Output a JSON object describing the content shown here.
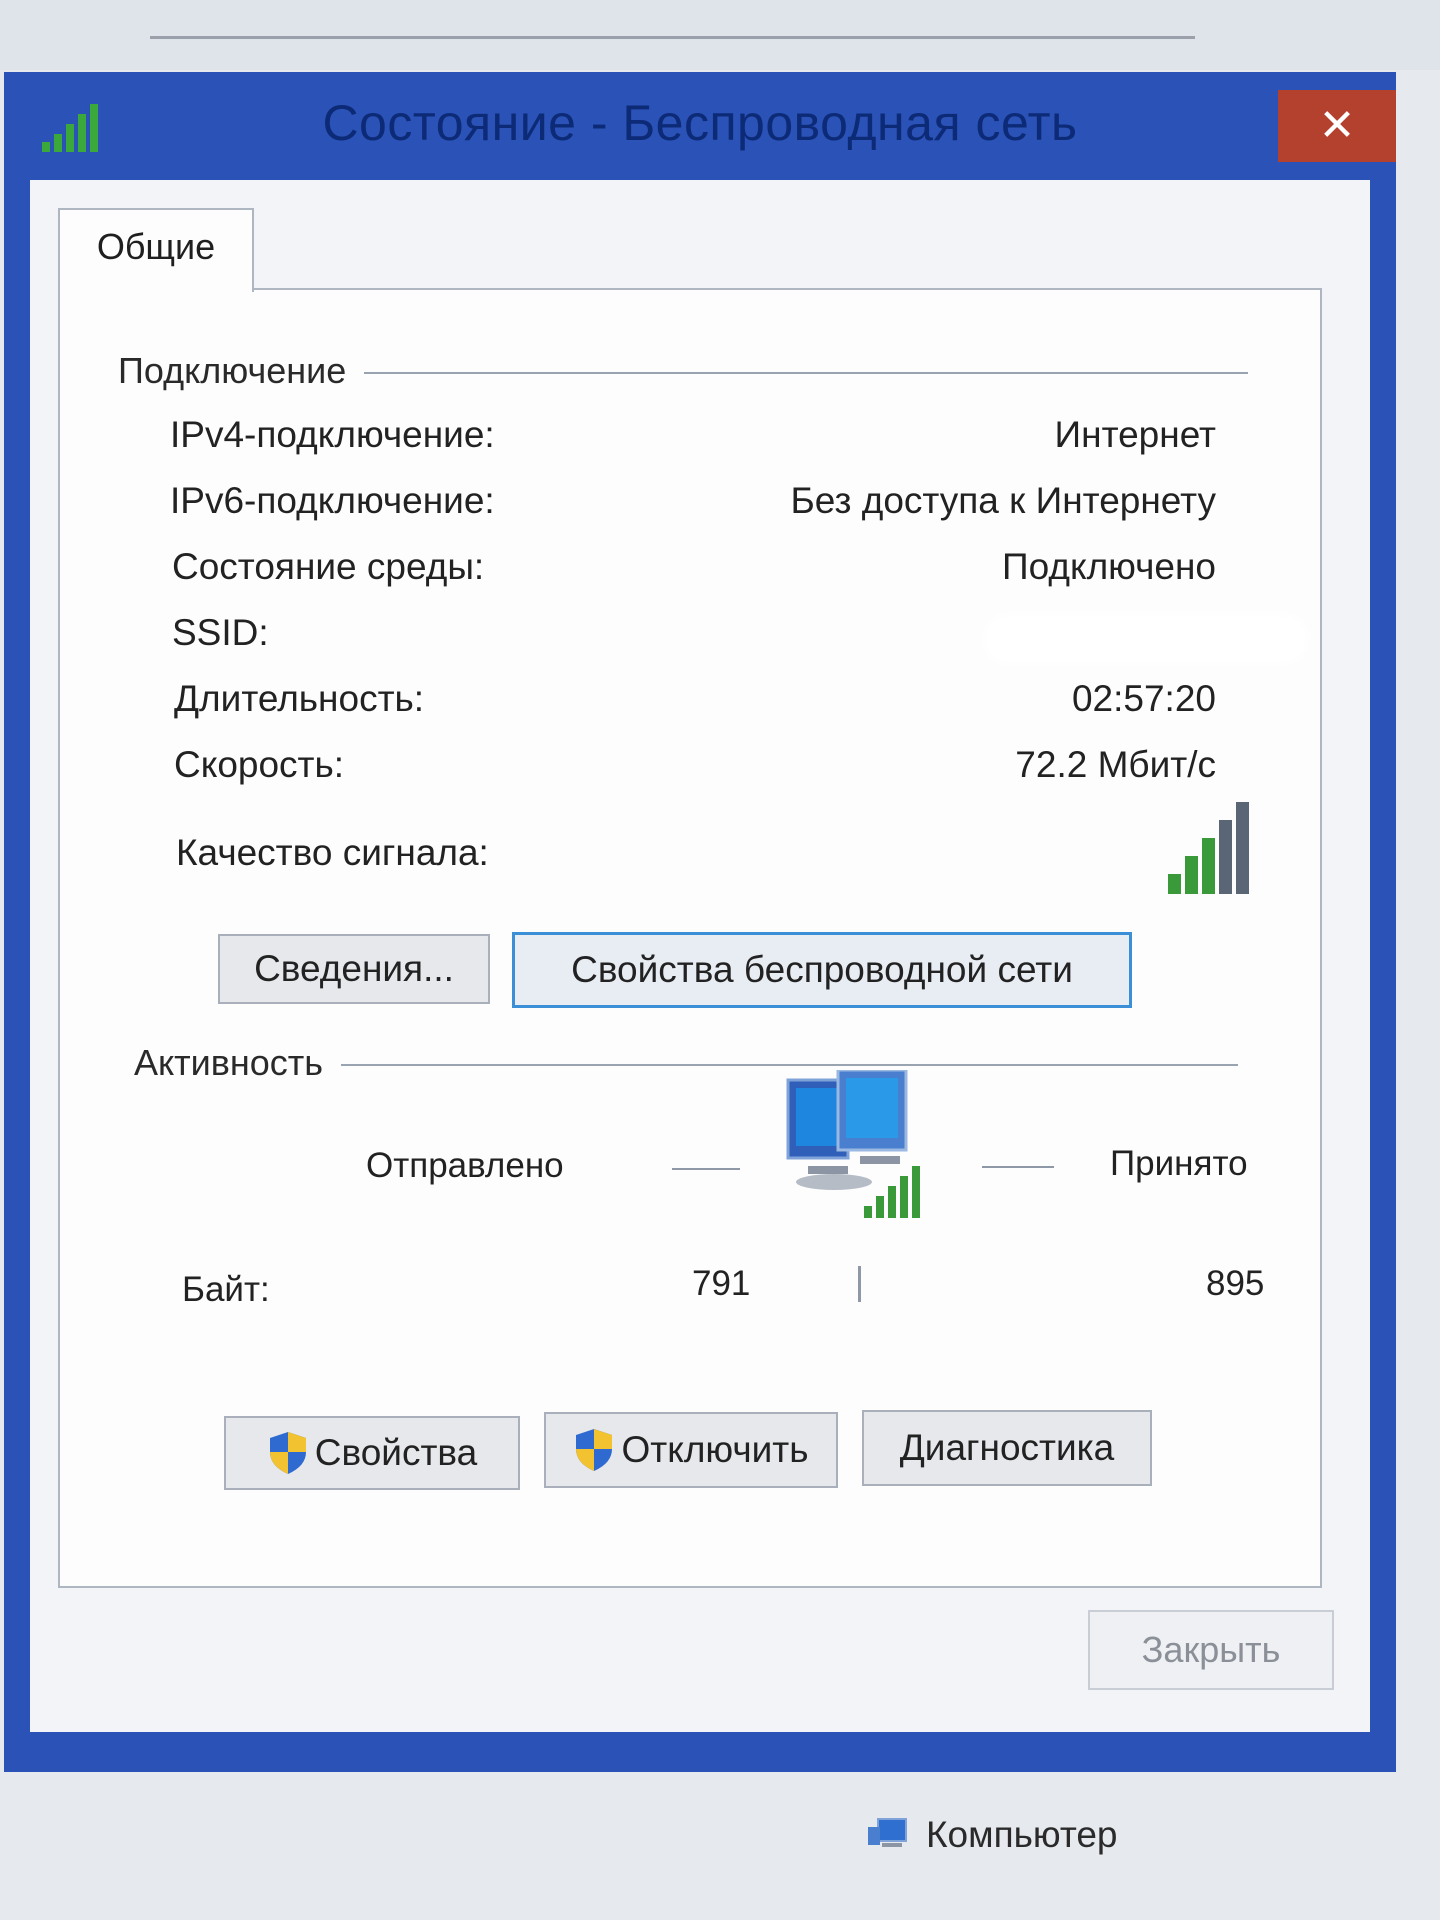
{
  "window": {
    "title": "Состояние - Беспроводная сеть",
    "close_glyph": "✕"
  },
  "tabs": [
    {
      "label": "Общие",
      "selected": true
    }
  ],
  "connection": {
    "group_title": "Подключение",
    "rows": [
      {
        "label": "IPv4-подключение:",
        "value": "Интернет"
      },
      {
        "label": "IPv6-подключение:",
        "value": "Без доступа к Интернету"
      },
      {
        "label": "Состояние среды:",
        "value": "Подключено"
      },
      {
        "label": "SSID:",
        "value": ""
      },
      {
        "label": "Длительность:",
        "value": "02:57:20"
      },
      {
        "label": "Скорость:",
        "value": "72.2 Мбит/с"
      }
    ],
    "signal_label": "Качество сигнала:",
    "signal_bars_lit": 3,
    "signal_bars_total": 5,
    "details_button": "Сведения...",
    "wireless_props_button": "Свойства беспроводной сети"
  },
  "activity": {
    "group_title": "Активность",
    "sent_label": "Отправлено",
    "received_label": "Принято",
    "bytes_label": "Байт:",
    "bytes_sent": "791",
    "bytes_received": "895"
  },
  "actions": {
    "properties": "Свойства",
    "disconnect": "Отключить",
    "diagnostics": "Диагностика"
  },
  "close_button": "Закрыть",
  "taskbar": {
    "computer_label": "Компьютер"
  },
  "icons": {
    "title": "wifi-signal-icon",
    "signal": "signal-strength-icon",
    "network": "network-computers-icon",
    "shield": "uac-shield-icon",
    "computer": "computer-icon"
  },
  "colors": {
    "title_bar": "#2a52b7",
    "close_button": "#b4402e",
    "signal_green": "#3a9a3a",
    "focus_border": "#3b8fd6"
  }
}
